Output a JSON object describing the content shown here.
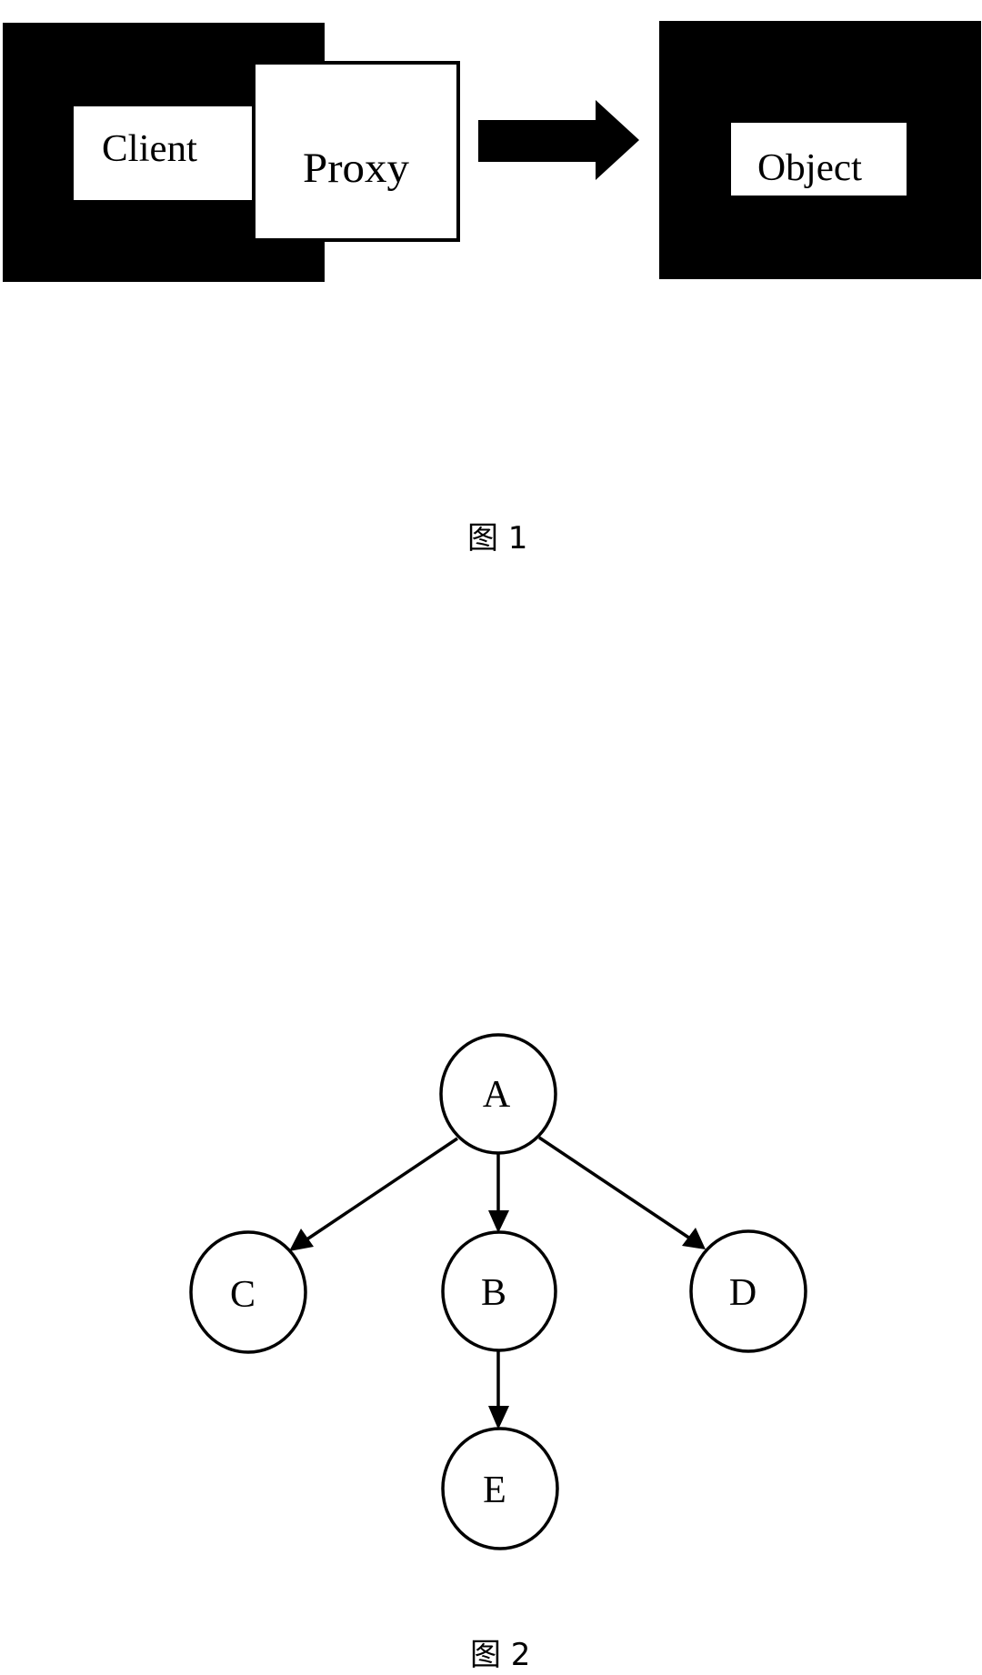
{
  "figure1": {
    "caption": "图 1",
    "client_label": "Client",
    "proxy_label": "Proxy",
    "object_label": "Object",
    "colors": {
      "frame": "#000000",
      "box": "#ffffff",
      "arrow": "#000000"
    }
  },
  "figure2": {
    "caption": "图 2",
    "nodes": [
      {
        "id": "A",
        "label": "A"
      },
      {
        "id": "B",
        "label": "B"
      },
      {
        "id": "C",
        "label": "C"
      },
      {
        "id": "D",
        "label": "D"
      },
      {
        "id": "E",
        "label": "E"
      }
    ],
    "edges": [
      {
        "from": "A",
        "to": "C"
      },
      {
        "from": "A",
        "to": "B"
      },
      {
        "from": "A",
        "to": "D"
      },
      {
        "from": "B",
        "to": "E"
      }
    ]
  }
}
